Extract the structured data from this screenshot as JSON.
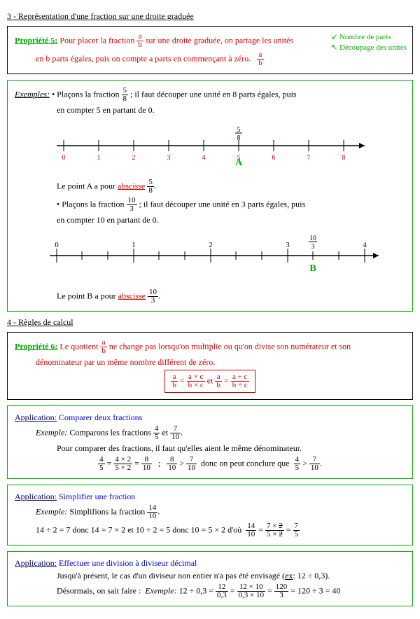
{
  "section3": {
    "title": "3 - Représentation d'une fraction sur une droite graduée",
    "prop5": {
      "label": "Propriété 5:",
      "text1": "Pour placer la fraction",
      "frac_a": "a",
      "frac_b": "b",
      "text2": "sur une droite graduée, on partage les unités",
      "text3": "en b parts égales, puis on compte a parts en commençant à zéro.",
      "annot1": "Nombre de parts",
      "annot2": "Découpage des unités"
    },
    "examples": {
      "label": "Exemples:",
      "ex1_intro_a": "• Plaçons la fraction",
      "ex1_frac_n": "5",
      "ex1_frac_d": "8",
      "ex1_intro_b": "; il faut découper une unité en 8 parts égales, puis",
      "ex1_intro_c": "en compter 5 en partant de 0.",
      "ex1_result_a": "Le point A a pour",
      "abscisse": "abscisse",
      "ex2_intro_a": "• Plaçons la fraction",
      "ex2_frac_n": "10",
      "ex2_frac_d": "3",
      "ex2_intro_b": "; il faut découper une unité en 3 parts égales, puis",
      "ex2_intro_c": "en compter 10 en partant de 0.",
      "ex2_result_a": "Le point B a pour"
    }
  },
  "section4": {
    "title": "4 - Règles de calcul",
    "prop6": {
      "label": "Propriété 6:",
      "text1": "Le quotient",
      "text2": "ne change pas lorsqu'on multiplie ou qu'on divise son numérateur et son",
      "text3": "dénominateur par un même nombre différent de zéro.",
      "formula_n1": "a",
      "formula_d1": "b",
      "formula_eq": "=",
      "formula_n2": "a × c",
      "formula_d2": "b × c",
      "formula_et": "et",
      "formula_n3": "a",
      "formula_d3": "b",
      "formula_n4": "a ÷ c",
      "formula_d4": "b ÷ c"
    },
    "app1": {
      "label": "Application:",
      "title": "Comparer deux fractions",
      "ex_label": "Exemple:",
      "ex_text": "Comparons les fractions",
      "f1n": "4",
      "f1d": "5",
      "et": "et",
      "f2n": "7",
      "f2d": "10",
      "explain": "Pour comparer des fractions, il faut qu'elles aient le même dénominateur.",
      "calc_n1": "4",
      "calc_d1": "5",
      "calc_n2": "4 × 2",
      "calc_d2": "5 × 2",
      "calc_n3": "8",
      "calc_d3": "10",
      "sep": ";",
      "cmp_n1": "8",
      "cmp_d1": "10",
      "gt": ">",
      "cmp_n2": "7",
      "cmp_d2": "10",
      "conclude": "donc on peut conclure que",
      "res_n1": "4",
      "res_d1": "5",
      "res_n2": "7",
      "res_d2": "10"
    },
    "app2": {
      "label": "Application:",
      "title": "Simplifier une fraction",
      "ex_label": "Exemple:",
      "ex_text": "Simplifions la fraction",
      "fn": "14",
      "fd": "10",
      "line": "14 ÷ 2 = 7 donc 14 = 7 × 2   et   10 ÷ 2 = 5 donc 10 = 5 × 2   d'où",
      "rn1": "14",
      "rd1": "10",
      "rn2a": "7 ×",
      "rn2b": "2",
      "rd2a": "5 ×",
      "rd2b": "2",
      "rn3": "7",
      "rd3": "5"
    },
    "app3": {
      "label": "Application:",
      "title": "Effectuer une division à diviseur décimal",
      "line1a": "Jusqu'à présent, le cas d'un diviseur non entier n'a pas été envisagé (",
      "ex_abbr": "ex",
      "line1b": ": 12 ÷ 0,3).",
      "line2a": "Désormais, on sait faire :",
      "ex_label": "Exemple:",
      "calc_start": "12 ÷ 0,3 =",
      "n1": "12",
      "d1": "0,3",
      "n2": "12 × 10",
      "d2": "0,3 × 10",
      "n3": "120",
      "d3": "3",
      "calc_end": "= 120 ÷ 3 = 40"
    }
  }
}
